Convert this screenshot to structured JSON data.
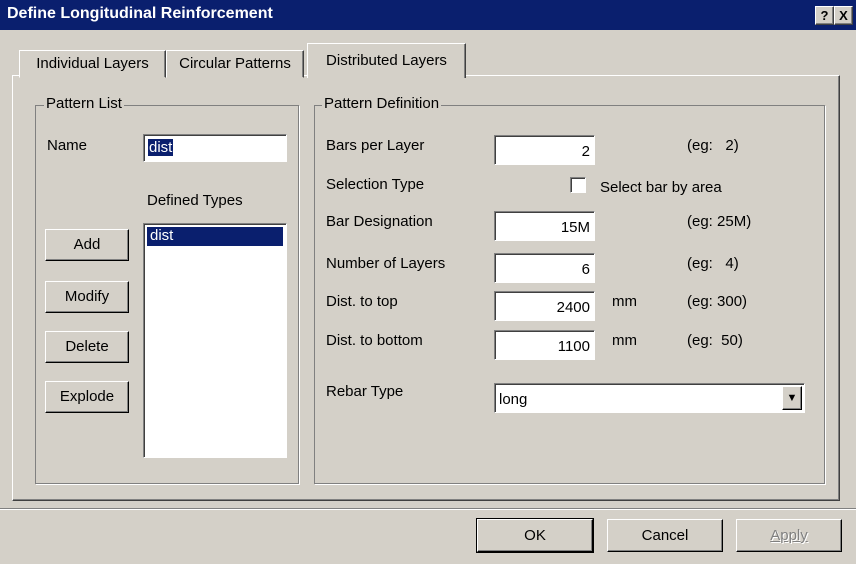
{
  "window": {
    "title": "Define Longitudinal Reinforcement",
    "help_glyph": "?",
    "close_glyph": "X"
  },
  "tabs": [
    {
      "label": "Individual Layers",
      "active": false
    },
    {
      "label": "Circular Patterns",
      "active": false
    },
    {
      "label": "Distributed Layers",
      "active": true
    }
  ],
  "pattern_list": {
    "legend": "Pattern List",
    "name_label": "Name",
    "name_value": "dist",
    "defined_types_label": "Defined Types",
    "defined_types": [
      "dist"
    ],
    "selected": "dist",
    "add_label": "Add",
    "modify_label": "Modify",
    "delete_label": "Delete",
    "explode_label": "Explode"
  },
  "pattern_definition": {
    "legend": "Pattern Definition",
    "bars_per_layer": {
      "label": "Bars per Layer",
      "value": "2",
      "unit": "",
      "example": "(eg:   2)"
    },
    "selection_type": {
      "label": "Selection Type",
      "checkbox_label": "Select bar by area",
      "checked": false
    },
    "bar_designation": {
      "label": "Bar Designation",
      "value": "15M",
      "unit": "",
      "example": "(eg: 25M)"
    },
    "number_of_layers": {
      "label": "Number of Layers",
      "value": "6",
      "unit": "",
      "example": "(eg:   4)"
    },
    "dist_to_top": {
      "label": "Dist. to top",
      "value": "2400",
      "unit": "mm",
      "example": "(eg: 300)"
    },
    "dist_to_bottom": {
      "label": "Dist. to bottom",
      "value": "1100",
      "unit": "mm",
      "example": "(eg:  50)"
    },
    "rebar_type": {
      "label": "Rebar Type",
      "value": "long"
    }
  },
  "footer": {
    "ok_label": "OK",
    "cancel_label": "Cancel",
    "apply_label": "Apply"
  },
  "icons": {
    "dropdown": "chevron-down-icon"
  }
}
